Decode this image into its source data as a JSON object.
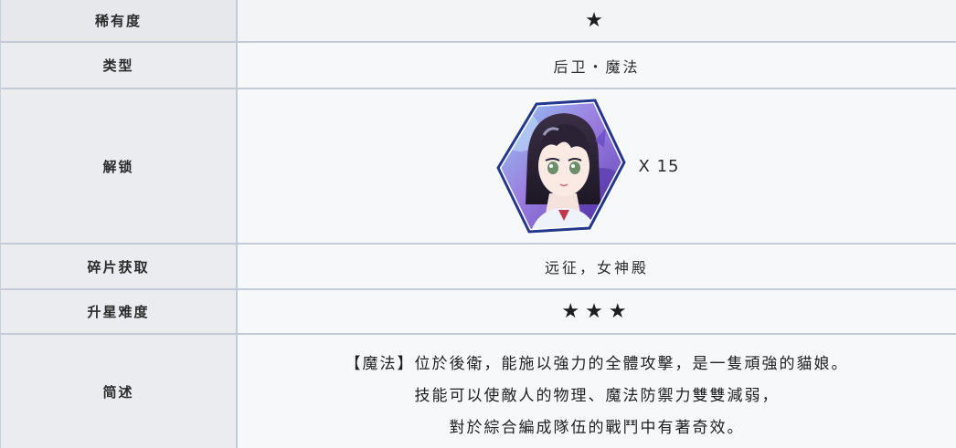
{
  "rows": {
    "rarity": {
      "label": "稀有度",
      "value": "★"
    },
    "type": {
      "label": "类型",
      "value": "后卫・魔法"
    },
    "unlock": {
      "label": "解锁",
      "quantity": "X 15",
      "icon": "character-portrait-icon"
    },
    "shards": {
      "label": "碎片获取",
      "value": "远征，女神殿"
    },
    "star_up": {
      "label": "升星难度",
      "value": "★★★"
    },
    "description": {
      "label": "简述",
      "lines": [
        "【魔法】位於後衛，能施以強力的全體攻擊，是一隻頑強的貓娘。",
        "技能可以使敵人的物理、魔法防禦力雙雙減弱，",
        "對於綜合編成隊伍的戰鬥中有著奇效。"
      ]
    }
  },
  "colors": {
    "label_bg": "#eaecef",
    "value_bg": "#f7f8fa",
    "border": "#c4cad6",
    "hex_border": "#2a3f8f"
  }
}
